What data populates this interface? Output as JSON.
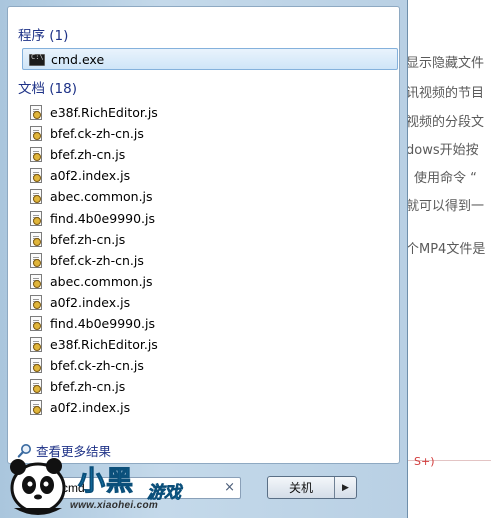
{
  "programs": {
    "header": "程序 (1)",
    "items": [
      {
        "label": "cmd.exe",
        "icon": "cmd-icon"
      }
    ]
  },
  "documents": {
    "header": "文档 (18)",
    "items": [
      {
        "label": "e38f.RichEditor.js",
        "icon": "script-file-icon"
      },
      {
        "label": "bfef.ck-zh-cn.js",
        "icon": "script-file-icon"
      },
      {
        "label": "bfef.zh-cn.js",
        "icon": "script-file-icon"
      },
      {
        "label": "a0f2.index.js",
        "icon": "script-file-icon"
      },
      {
        "label": "abec.common.js",
        "icon": "script-file-icon"
      },
      {
        "label": "find.4b0e9990.js",
        "icon": "script-file-icon"
      },
      {
        "label": "bfef.zh-cn.js",
        "icon": "script-file-icon"
      },
      {
        "label": "bfef.ck-zh-cn.js",
        "icon": "script-file-icon"
      },
      {
        "label": "abec.common.js",
        "icon": "script-file-icon"
      },
      {
        "label": "a0f2.index.js",
        "icon": "script-file-icon"
      },
      {
        "label": "find.4b0e9990.js",
        "icon": "script-file-icon"
      },
      {
        "label": "e38f.RichEditor.js",
        "icon": "script-file-icon"
      },
      {
        "label": "bfef.ck-zh-cn.js",
        "icon": "script-file-icon"
      },
      {
        "label": "bfef.zh-cn.js",
        "icon": "script-file-icon"
      },
      {
        "label": "a0f2.index.js",
        "icon": "script-file-icon"
      }
    ]
  },
  "see_more": "查看更多结果",
  "search": {
    "value": "cmd",
    "clear_symbol": "×"
  },
  "shutdown": {
    "label": "关机",
    "arrow": "▶"
  },
  "background_text": [
    "显示隐藏文件",
    "讯视频的节目",
    "视频的分段文",
    "dows开始按",
    "使用命令 “",
    "就可以得到一",
    "个MP4文件是"
  ],
  "background_red": "S+)",
  "watermark": {
    "text": "小黑游戏",
    "url": "www.xiaohei.com"
  },
  "colors": {
    "header": "#1e3287",
    "selection": "#cfe5f8",
    "logo": "#1ea6e6"
  }
}
